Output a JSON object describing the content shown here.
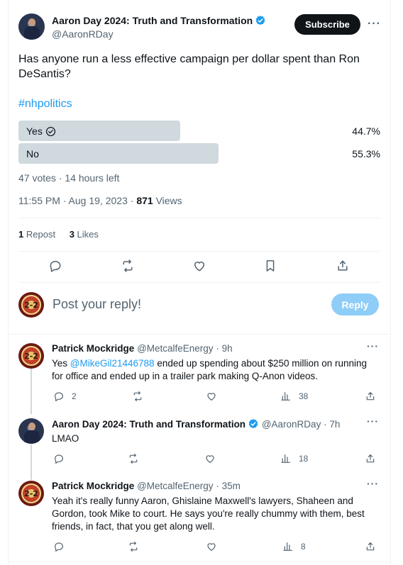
{
  "tweet": {
    "author_name": "Aaron Day 2024: Truth and Transformation",
    "author_handle": "@AaronRDay",
    "subscribe_label": "Subscribe",
    "more_label": "···",
    "text": "Has anyone run a less effective campaign per dollar spent than Ron DeSantis?",
    "hashtag": "#nhpolitics",
    "poll": {
      "options": [
        {
          "label": "Yes",
          "percent": "44.7%",
          "fraction": 0.447,
          "selected": true
        },
        {
          "label": "No",
          "percent": "55.3%",
          "fraction": 0.553,
          "selected": false
        }
      ],
      "votes": "47 votes",
      "time_left": "14 hours left"
    },
    "timestamp": "11:55 PM · Aug 19, 2023",
    "views_count": "871",
    "views_label": "Views",
    "reposts_count": "1",
    "reposts_label": "Repost",
    "likes_count": "3",
    "likes_label": "Likes"
  },
  "reply_composer": {
    "placeholder": "Post your reply!",
    "reply_button": "Reply"
  },
  "replies": [
    {
      "name": "Patrick Mockridge",
      "handle": "@MetcalfeEnergy",
      "time": "· 9h",
      "text_before": "Yes ",
      "mention": "@MikeGil21446788",
      "text_after": " ended up spending about $250 million on running for office and ended up in a trailer park making Q-Anon videos.",
      "reply_count": "2",
      "views": "38"
    },
    {
      "name": "Aaron Day 2024: Truth and Transformation",
      "handle": "@AaronRDay",
      "time": "· 7h",
      "text": "LMAO",
      "views": "18"
    },
    {
      "name": "Patrick Mockridge",
      "handle": "@MetcalfeEnergy",
      "time": "· 35m",
      "text": "Yeah it's really funny Aaron, Ghislaine Maxwell's lawyers, Shaheen and Gordon, took Mike to court. He says you're really chummy with them, best friends, in fact, that you get along well.",
      "views": "8"
    }
  ],
  "avatar_badge_text": "2-2",
  "colors": {
    "accent": "#1d9bf0",
    "reply_button_disabled": "#8ecdf7",
    "poll_bar": "#cfd9de"
  }
}
